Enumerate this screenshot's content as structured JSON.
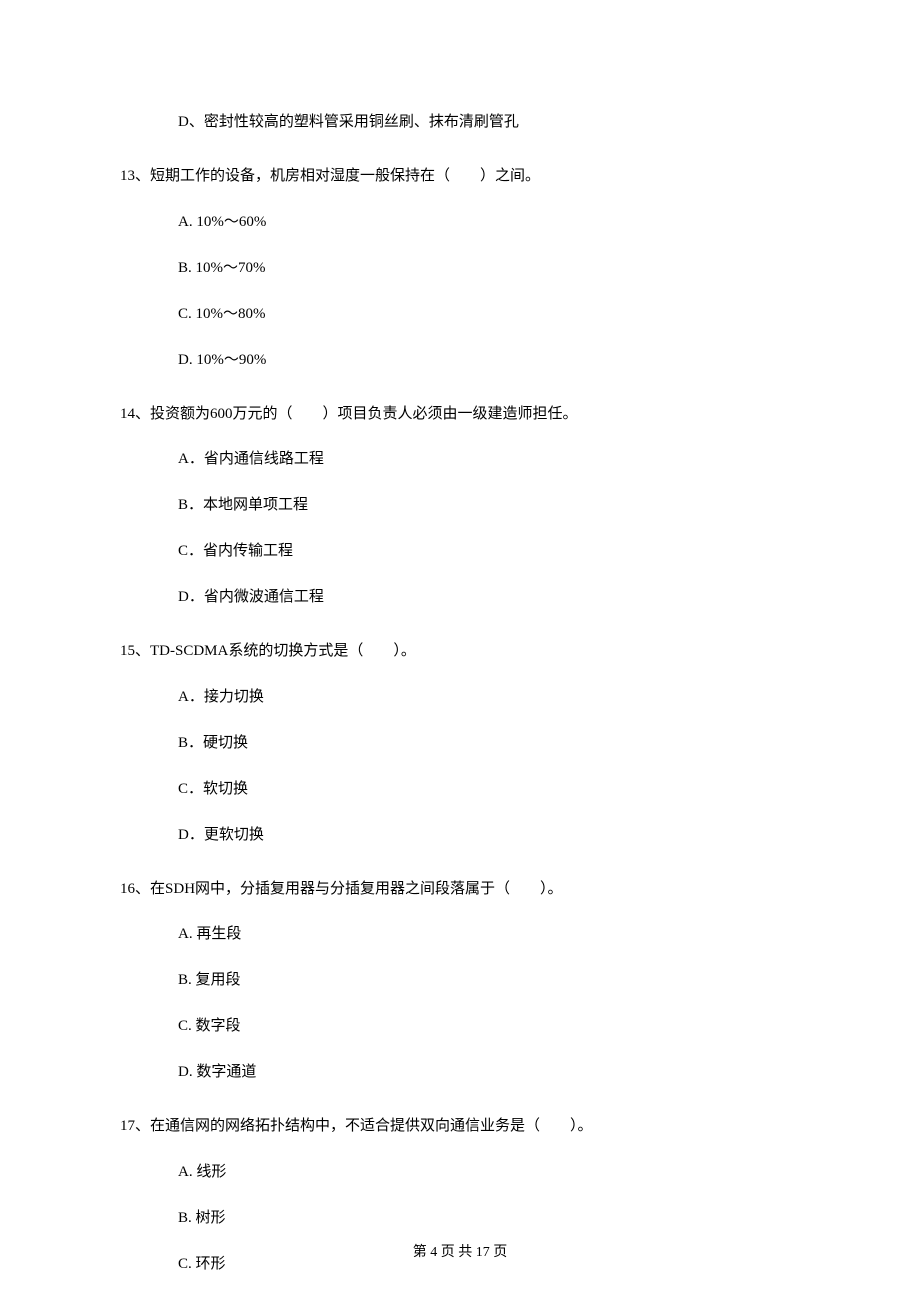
{
  "orphanOption": "D、密封性较高的塑料管采用铜丝刷、抹布清刷管孔",
  "questions": [
    {
      "number": "13、",
      "stem": "短期工作的设备，机房相对湿度一般保持在（　　）之间。",
      "options": [
        "A. 10%～60%",
        "B. 10%～70%",
        "C. 10%～80%",
        "D. 10%～90%"
      ]
    },
    {
      "number": "14、",
      "stem": "投资额为600万元的（　　）项目负责人必须由一级建造师担任。",
      "options": [
        "A．省内通信线路工程",
        "B．本地网单项工程",
        "C．省内传输工程",
        "D．省内微波通信工程"
      ]
    },
    {
      "number": "15、",
      "stem": "TD-SCDMA系统的切换方式是（　　）。",
      "options": [
        "A．接力切换",
        "B．硬切换",
        "C．软切换",
        "D．更软切换"
      ]
    },
    {
      "number": "16、",
      "stem": "在SDH网中，分插复用器与分插复用器之间段落属于（　　）。",
      "options": [
        "A. 再生段",
        "B. 复用段",
        "C. 数字段",
        "D. 数字通道"
      ]
    },
    {
      "number": "17、",
      "stem": "在通信网的网络拓扑结构中，不适合提供双向通信业务是（　　）。",
      "options": [
        "A. 线形",
        "B. 树形",
        "C. 环形"
      ]
    }
  ],
  "footer": "第 4 页 共 17 页"
}
